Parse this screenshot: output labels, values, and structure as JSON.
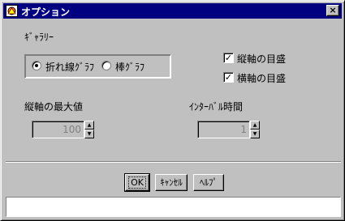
{
  "window": {
    "title": "オプション",
    "close_label": "×"
  },
  "gallery": {
    "label": "ｷﾞｬﾗﾘｰ",
    "options": [
      {
        "label": "折れ線ｸﾞﾗﾌ",
        "selected": true
      },
      {
        "label": "棒ｸﾞﾗﾌ",
        "selected": false
      }
    ]
  },
  "gridlines": [
    {
      "label": "縦軸の目盛",
      "checked": true,
      "mark": "✓"
    },
    {
      "label": "横軸の目盛",
      "checked": true,
      "mark": "✓"
    }
  ],
  "max_value": {
    "label": "縦軸の最大値",
    "value": "100"
  },
  "interval": {
    "label": "ｲﾝﾀｰﾊﾞﾙ時間",
    "value": "1"
  },
  "spinner": {
    "up": "▲",
    "down": "▼"
  },
  "buttons": {
    "ok": "OK",
    "cancel": "ｷｬﾝｾﾙ",
    "help": "ﾍﾙﾌﾟ"
  },
  "status": {
    "text": ""
  }
}
